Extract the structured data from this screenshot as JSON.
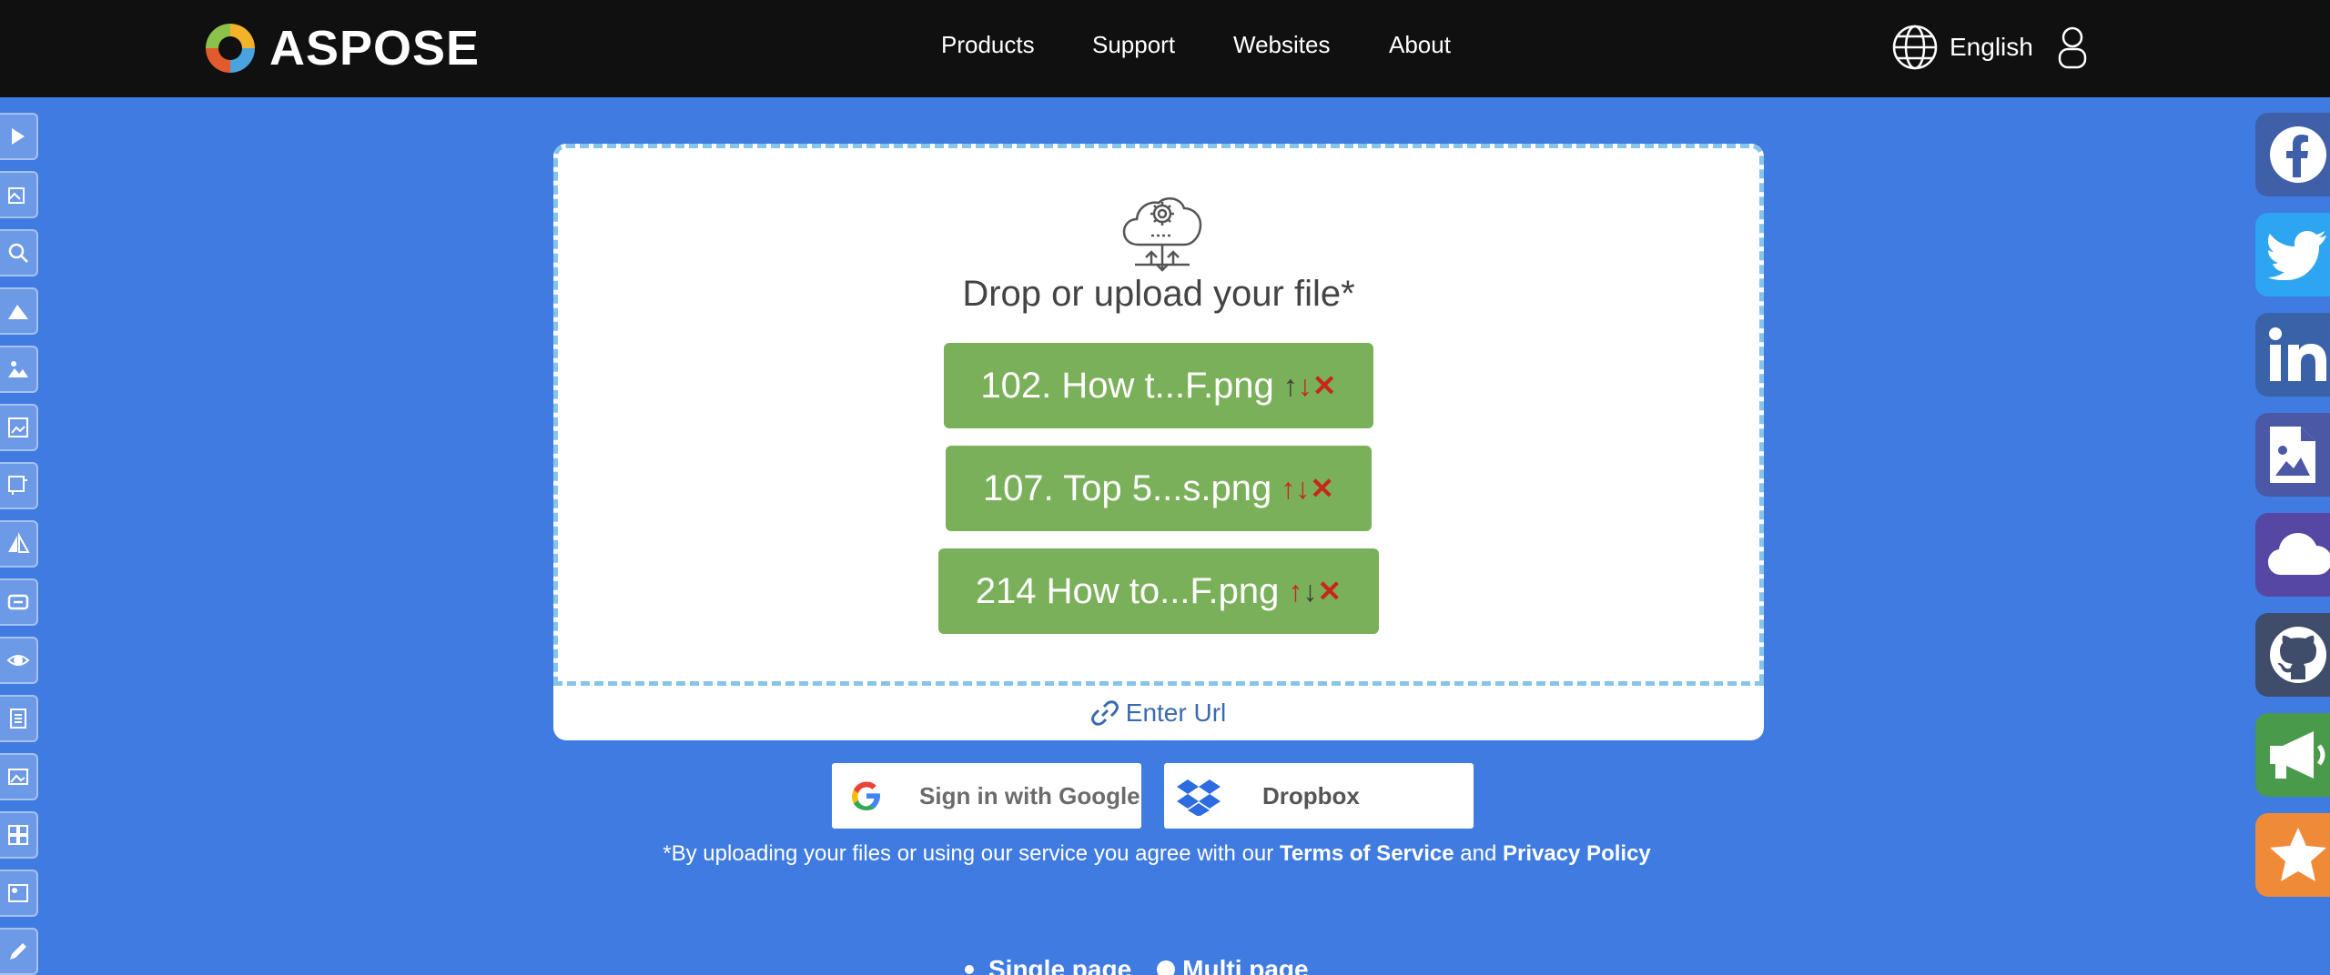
{
  "header": {
    "brand": "ASPOSE",
    "nav": [
      "Products",
      "Support",
      "Websites",
      "About"
    ],
    "language": "English"
  },
  "upload": {
    "title": "Drop or upload your file*",
    "files": [
      {
        "name": "102. How t...F.png"
      },
      {
        "name": "107. Top 5...s.png"
      },
      {
        "name": "214 How to...F.png"
      }
    ],
    "enter_url": "Enter Url"
  },
  "auth": {
    "google": "Sign in with Google",
    "dropbox": "Dropbox"
  },
  "terms": {
    "prefix": "*By uploading your files or using our service you agree with our ",
    "tos": "Terms of Service",
    "and": " and ",
    "privacy": "Privacy Policy"
  },
  "options": {
    "single": "Single page",
    "multi": "Multi page"
  },
  "social": [
    {
      "icon": "facebook-icon",
      "color": "#3f5fa8"
    },
    {
      "icon": "twitter-icon",
      "color": "#2ea5f0"
    },
    {
      "icon": "linkedin-icon",
      "color": "#3a62a8"
    },
    {
      "icon": "file-image-icon",
      "color": "#4a58a5"
    },
    {
      "icon": "cloud-icon",
      "color": "#5747a4"
    },
    {
      "icon": "github-icon",
      "color": "#3f4d6b"
    },
    {
      "icon": "megaphone-icon",
      "color": "#4a9a4c"
    },
    {
      "icon": "star-icon",
      "color": "#ef8a37"
    }
  ],
  "colors": {
    "background": "#3f7be0",
    "header": "#101010",
    "file_button": "#7ab05a",
    "dropzone_border": "#87c4ea"
  }
}
